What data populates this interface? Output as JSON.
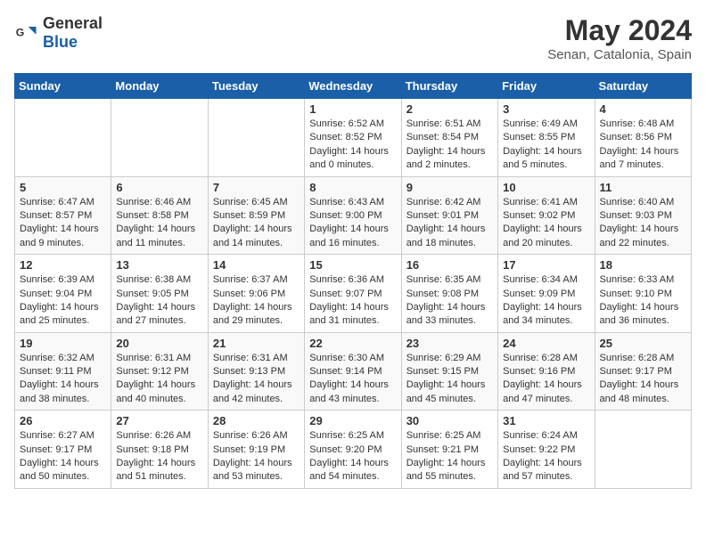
{
  "header": {
    "logo_general": "General",
    "logo_blue": "Blue",
    "title": "May 2024",
    "subtitle": "Senan, Catalonia, Spain"
  },
  "days_of_week": [
    "Sunday",
    "Monday",
    "Tuesday",
    "Wednesday",
    "Thursday",
    "Friday",
    "Saturday"
  ],
  "weeks": [
    {
      "days": [
        {
          "num": "",
          "info": ""
        },
        {
          "num": "",
          "info": ""
        },
        {
          "num": "",
          "info": ""
        },
        {
          "num": "1",
          "info": "Sunrise: 6:52 AM\nSunset: 8:52 PM\nDaylight: 14 hours\nand 0 minutes."
        },
        {
          "num": "2",
          "info": "Sunrise: 6:51 AM\nSunset: 8:54 PM\nDaylight: 14 hours\nand 2 minutes."
        },
        {
          "num": "3",
          "info": "Sunrise: 6:49 AM\nSunset: 8:55 PM\nDaylight: 14 hours\nand 5 minutes."
        },
        {
          "num": "4",
          "info": "Sunrise: 6:48 AM\nSunset: 8:56 PM\nDaylight: 14 hours\nand 7 minutes."
        }
      ]
    },
    {
      "days": [
        {
          "num": "5",
          "info": "Sunrise: 6:47 AM\nSunset: 8:57 PM\nDaylight: 14 hours\nand 9 minutes."
        },
        {
          "num": "6",
          "info": "Sunrise: 6:46 AM\nSunset: 8:58 PM\nDaylight: 14 hours\nand 11 minutes."
        },
        {
          "num": "7",
          "info": "Sunrise: 6:45 AM\nSunset: 8:59 PM\nDaylight: 14 hours\nand 14 minutes."
        },
        {
          "num": "8",
          "info": "Sunrise: 6:43 AM\nSunset: 9:00 PM\nDaylight: 14 hours\nand 16 minutes."
        },
        {
          "num": "9",
          "info": "Sunrise: 6:42 AM\nSunset: 9:01 PM\nDaylight: 14 hours\nand 18 minutes."
        },
        {
          "num": "10",
          "info": "Sunrise: 6:41 AM\nSunset: 9:02 PM\nDaylight: 14 hours\nand 20 minutes."
        },
        {
          "num": "11",
          "info": "Sunrise: 6:40 AM\nSunset: 9:03 PM\nDaylight: 14 hours\nand 22 minutes."
        }
      ]
    },
    {
      "days": [
        {
          "num": "12",
          "info": "Sunrise: 6:39 AM\nSunset: 9:04 PM\nDaylight: 14 hours\nand 25 minutes."
        },
        {
          "num": "13",
          "info": "Sunrise: 6:38 AM\nSunset: 9:05 PM\nDaylight: 14 hours\nand 27 minutes."
        },
        {
          "num": "14",
          "info": "Sunrise: 6:37 AM\nSunset: 9:06 PM\nDaylight: 14 hours\nand 29 minutes."
        },
        {
          "num": "15",
          "info": "Sunrise: 6:36 AM\nSunset: 9:07 PM\nDaylight: 14 hours\nand 31 minutes."
        },
        {
          "num": "16",
          "info": "Sunrise: 6:35 AM\nSunset: 9:08 PM\nDaylight: 14 hours\nand 33 minutes."
        },
        {
          "num": "17",
          "info": "Sunrise: 6:34 AM\nSunset: 9:09 PM\nDaylight: 14 hours\nand 34 minutes."
        },
        {
          "num": "18",
          "info": "Sunrise: 6:33 AM\nSunset: 9:10 PM\nDaylight: 14 hours\nand 36 minutes."
        }
      ]
    },
    {
      "days": [
        {
          "num": "19",
          "info": "Sunrise: 6:32 AM\nSunset: 9:11 PM\nDaylight: 14 hours\nand 38 minutes."
        },
        {
          "num": "20",
          "info": "Sunrise: 6:31 AM\nSunset: 9:12 PM\nDaylight: 14 hours\nand 40 minutes."
        },
        {
          "num": "21",
          "info": "Sunrise: 6:31 AM\nSunset: 9:13 PM\nDaylight: 14 hours\nand 42 minutes."
        },
        {
          "num": "22",
          "info": "Sunrise: 6:30 AM\nSunset: 9:14 PM\nDaylight: 14 hours\nand 43 minutes."
        },
        {
          "num": "23",
          "info": "Sunrise: 6:29 AM\nSunset: 9:15 PM\nDaylight: 14 hours\nand 45 minutes."
        },
        {
          "num": "24",
          "info": "Sunrise: 6:28 AM\nSunset: 9:16 PM\nDaylight: 14 hours\nand 47 minutes."
        },
        {
          "num": "25",
          "info": "Sunrise: 6:28 AM\nSunset: 9:17 PM\nDaylight: 14 hours\nand 48 minutes."
        }
      ]
    },
    {
      "days": [
        {
          "num": "26",
          "info": "Sunrise: 6:27 AM\nSunset: 9:17 PM\nDaylight: 14 hours\nand 50 minutes."
        },
        {
          "num": "27",
          "info": "Sunrise: 6:26 AM\nSunset: 9:18 PM\nDaylight: 14 hours\nand 51 minutes."
        },
        {
          "num": "28",
          "info": "Sunrise: 6:26 AM\nSunset: 9:19 PM\nDaylight: 14 hours\nand 53 minutes."
        },
        {
          "num": "29",
          "info": "Sunrise: 6:25 AM\nSunset: 9:20 PM\nDaylight: 14 hours\nand 54 minutes."
        },
        {
          "num": "30",
          "info": "Sunrise: 6:25 AM\nSunset: 9:21 PM\nDaylight: 14 hours\nand 55 minutes."
        },
        {
          "num": "31",
          "info": "Sunrise: 6:24 AM\nSunset: 9:22 PM\nDaylight: 14 hours\nand 57 minutes."
        },
        {
          "num": "",
          "info": ""
        }
      ]
    }
  ]
}
